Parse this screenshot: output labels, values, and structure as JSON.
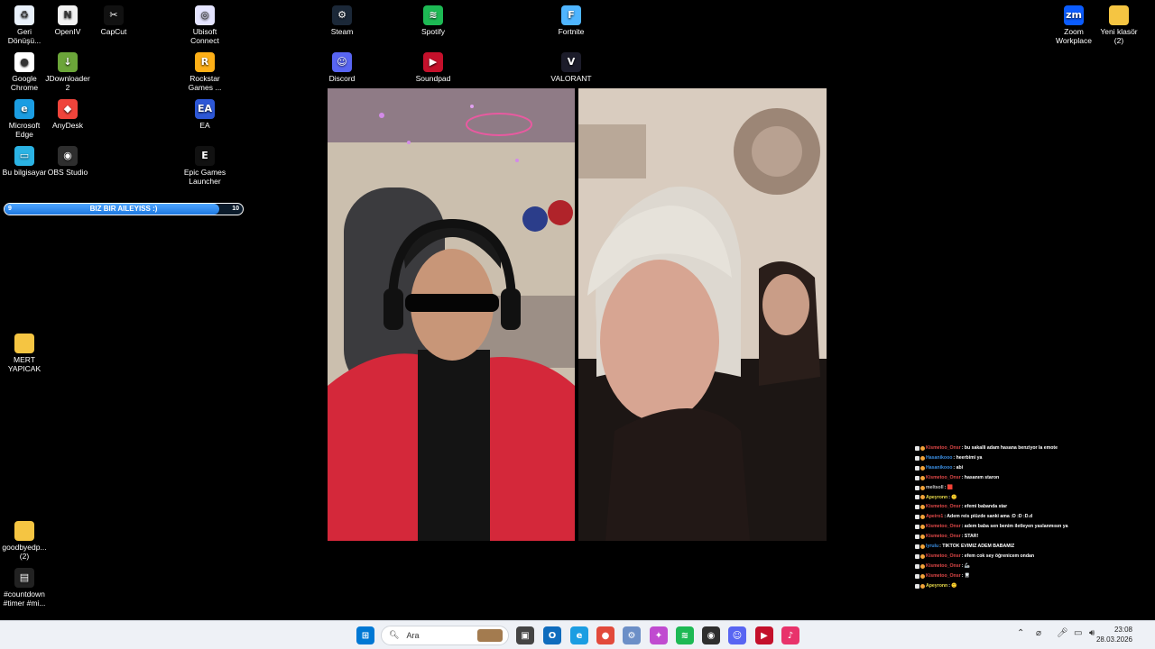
{
  "desktop_icons": [
    {
      "label": "Geri\nDönüşü...",
      "icon": "recycle-bin-icon",
      "color": "#e8f0fa"
    },
    {
      "label": "OpenIV",
      "icon": "openiv-icon",
      "color": "#f2f2f2"
    },
    {
      "label": "CapCut",
      "icon": "capcut-icon",
      "color": "#111111"
    },
    {
      "label": "Ubisoft\nConnect",
      "icon": "ubisoft-icon",
      "color": "#e4e4ff"
    },
    {
      "label": "Steam",
      "icon": "steam-icon",
      "color": "#1b2838"
    },
    {
      "label": "Spotify",
      "icon": "spotify-icon",
      "color": "#1db954"
    },
    {
      "label": "Fortnite",
      "icon": "fortnite-icon",
      "color": "#4fb5ff"
    },
    {
      "label": "Zoom\nWorkplace",
      "icon": "zoom-icon",
      "color": "#0b5cff"
    },
    {
      "label": "Yeni klasör\n(2)",
      "icon": "folder-icon",
      "color": "#f5c542"
    },
    {
      "label": "Google\nChrome",
      "icon": "chrome-icon",
      "color": "#ffffff"
    },
    {
      "label": "JDownloader\n2",
      "icon": "jdownloader-icon",
      "color": "#6ba539"
    },
    {
      "label": "Rockstar\nGames ...",
      "icon": "rockstar-icon",
      "color": "#fcaf17"
    },
    {
      "label": "Discord",
      "icon": "discord-icon",
      "color": "#5865f2"
    },
    {
      "label": "Soundpad",
      "icon": "soundpad-icon",
      "color": "#c4102b"
    },
    {
      "label": "VALORANT",
      "icon": "valorant-icon",
      "color": "#1c1c2a"
    },
    {
      "label": "Microsoft\nEdge",
      "icon": "edge-icon",
      "color": "#1b9de2"
    },
    {
      "label": "AnyDesk",
      "icon": "anydesk-icon",
      "color": "#ef443b"
    },
    {
      "label": "EA",
      "icon": "ea-icon",
      "color": "#2d57d6"
    },
    {
      "label": "Bu bilgisayar",
      "icon": "computer-icon",
      "color": "#2bb3e4"
    },
    {
      "label": "OBS Studio",
      "icon": "obs-icon",
      "color": "#2e2e2e"
    },
    {
      "label": "Epic Games\nLauncher",
      "icon": "epic-games-icon",
      "color": "#111111"
    },
    {
      "label": "MERT\nYAPICAK",
      "icon": "folder-icon",
      "color": "#f5c542"
    },
    {
      "label": "goodbyedp...\n(2)",
      "icon": "folder-icon",
      "color": "#f5c542"
    },
    {
      "label": "#countdown\n#timer #mi...",
      "icon": "video-file-icon",
      "color": "#222222"
    }
  ],
  "goal_bar": {
    "text": "BIZ BIR AILEYISS :)",
    "min": "9",
    "max": "10",
    "progress": 0.9
  },
  "chat": [
    {
      "user": "Kismetoo_Onsr",
      "color": "#e04848",
      "msg": ": bu sakalli adam hasana benziyor la emote"
    },
    {
      "user": "Hasanikooo",
      "color": "#3a8de0",
      "msg": ": heerbimi ya"
    },
    {
      "user": "Hasanikooo",
      "color": "#3a8de0",
      "msg": ": abi"
    },
    {
      "user": "Kismetoo_Onsr",
      "color": "#e04848",
      "msg": ": hasanım staron"
    },
    {
      "user": "meltsoll",
      "color": "#c8c8c8",
      "msg": ": 🟥"
    },
    {
      "user": "Apeyronn",
      "color": "#e8d94a",
      "msg": ": 🙂"
    },
    {
      "user": "Kismetoo_Onsr",
      "color": "#e04848",
      "msg": ": efemi babanda star"
    },
    {
      "user": "Apeiro1",
      "color": "#e04848",
      "msg": ": Adem reis piüzde sanki ama :D :D :D.d"
    },
    {
      "user": "Kismetoo_Onsr",
      "color": "#e04848",
      "msg": ": adem baba sen benim iletleyen yaslanmısın ya"
    },
    {
      "user": "Kismetoo_Onsr",
      "color": "#e04848",
      "msg": ": STAR!"
    },
    {
      "user": "lyrulu",
      "color": "#3a8de0",
      "msg": ": TIKTOK EVIMIZ ADEM BABAMIZ"
    },
    {
      "user": "Kismetoo_Onsr",
      "color": "#e04848",
      "msg": ": efem cok sey öğrenicem ondan"
    },
    {
      "user": "Kismetoo_Onsr",
      "color": "#e04848",
      "msg": ": 🦾"
    },
    {
      "user": "Kismetoo_Onsr",
      "color": "#e04848",
      "msg": ": 🦷"
    },
    {
      "user": "Apeyronn",
      "color": "#e8d94a",
      "msg": ": 🙂"
    }
  ],
  "taskbar": {
    "search_placeholder": "Ara",
    "time": "23:08",
    "date": "28.03.2026",
    "apps": [
      "start-icon",
      "task-view-icon",
      "outlook-icon",
      "edge-icon",
      "chrome-icon",
      "settings-icon",
      "copilot-icon",
      "spotify-icon",
      "obs-icon",
      "discord-icon",
      "soundpad-icon",
      "tiktok-icon"
    ]
  }
}
